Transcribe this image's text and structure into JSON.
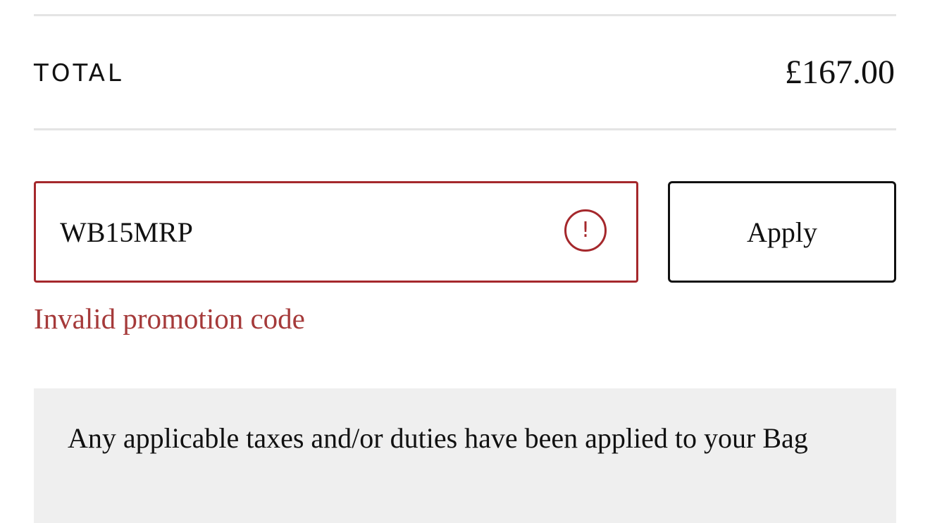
{
  "summary": {
    "total_label": "TOTAL",
    "total_value": "£167.00"
  },
  "promo": {
    "code_value": "WB15MRP",
    "apply_label": "Apply",
    "error_message": "Invalid promotion code",
    "error_icon": "exclamation-circle-icon",
    "error_color": "#a5282c"
  },
  "notice": {
    "text": "Any applicable taxes and/or duties have been applied to your Bag"
  }
}
